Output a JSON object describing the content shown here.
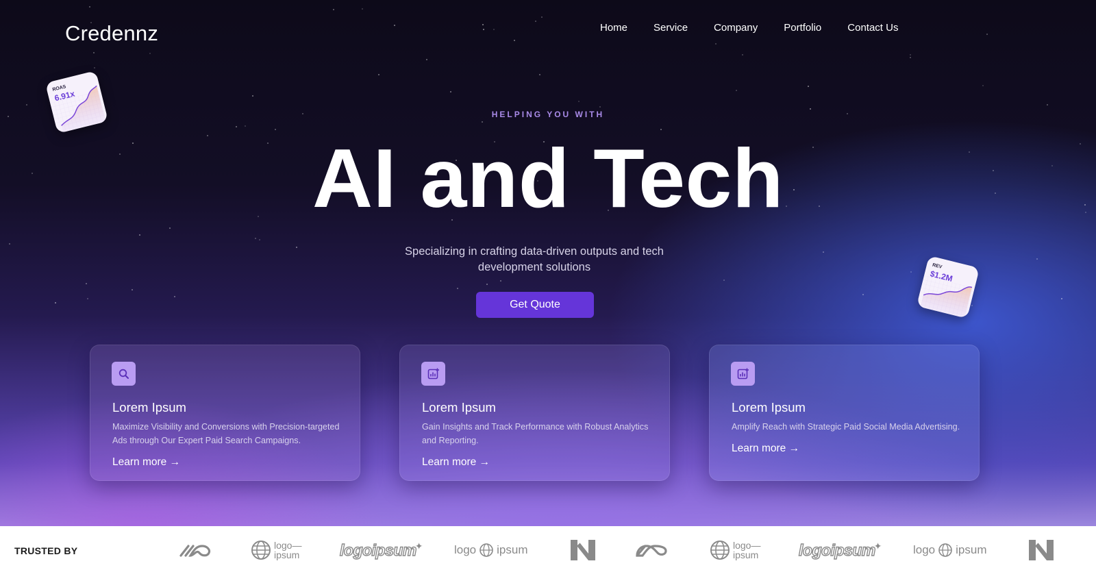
{
  "brand": {
    "name": "Credennz"
  },
  "nav": {
    "items": [
      {
        "label": "Home"
      },
      {
        "label": "Service"
      },
      {
        "label": "Company"
      },
      {
        "label": "Portfolio"
      },
      {
        "label": "Contact Us"
      }
    ]
  },
  "hero": {
    "eyebrow": "HELPING YOU WITH",
    "headline": "AI and Tech",
    "subtitle": "Specializing in crafting data-driven outputs and tech development solutions",
    "cta_label": "Get Quote"
  },
  "mini_cards": [
    {
      "label": "ROAS",
      "value": "6.91x"
    },
    {
      "label": "REV",
      "value": "$1.2M"
    }
  ],
  "cards": [
    {
      "icon": "search-icon",
      "title": "Lorem Ipsum",
      "description": "Maximize Visibility and Conversions with Precision-targeted Ads through Our Expert Paid Search Campaigns.",
      "link": "Learn more →"
    },
    {
      "icon": "analytics-chart-icon",
      "title": "Lorem Ipsum",
      "description": "Gain Insights and Track Performance with Robust Analytics and Reporting.",
      "link": "Learn more →"
    },
    {
      "icon": "analytics-chart-icon",
      "title": "Lorem Ipsum",
      "description": "Amplify Reach with Strategic Paid Social Media Advertising.",
      "link": "Learn more →"
    }
  ],
  "trusted": {
    "label": "TRUSTED BY",
    "logos": {
      "globe_top": "logo—",
      "globe_bottom": "ipsum",
      "script": "logoipsum",
      "left_word": "logo",
      "right_word": "ipsum"
    }
  },
  "colors": {
    "accent": "#6535d9",
    "eyebrow": "#a98ae8",
    "icon_box": "#b99cf2"
  }
}
